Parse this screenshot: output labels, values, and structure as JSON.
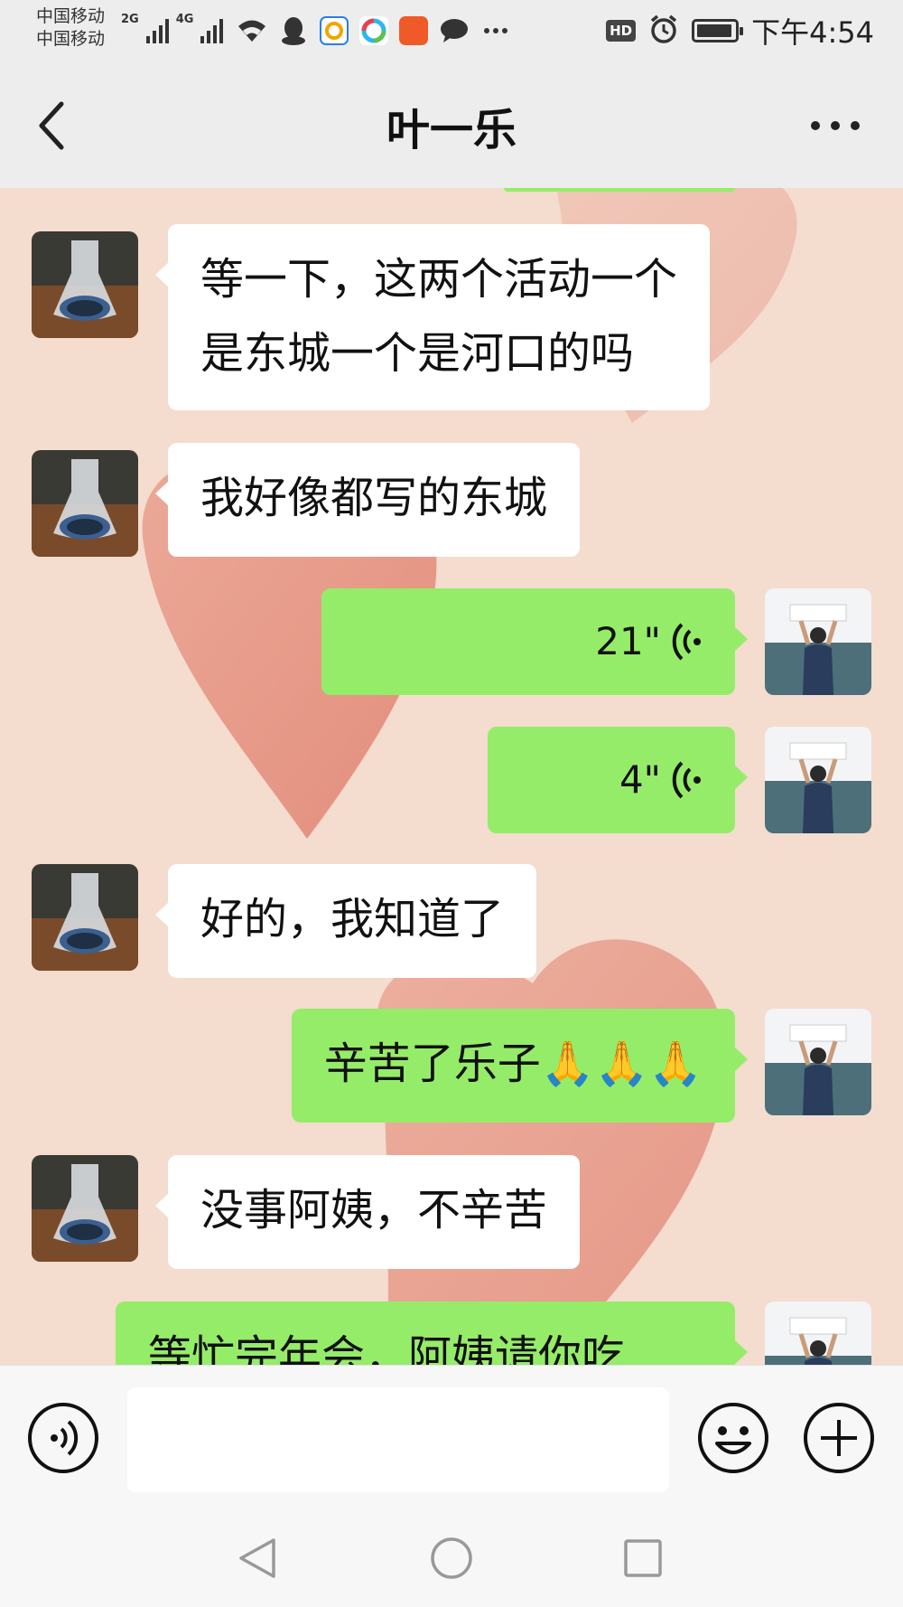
{
  "status_bar": {
    "carrier_1": "中国移动",
    "carrier_2": "中国移动",
    "net_1": "2G",
    "net_2": "4G",
    "hd": "HD",
    "time": "下午4:54",
    "battery_level": 0.95,
    "icons": [
      "signal-icon",
      "wifi-icon",
      "qq-icon",
      "app-icon",
      "app-icon",
      "app-icon",
      "chat-bubble-icon",
      "more-dots-icon",
      "alarm-icon",
      "battery-icon"
    ]
  },
  "header": {
    "title": "叶一乐",
    "back_icon": "chevron-left-icon",
    "more_icon": "more-dots-icon"
  },
  "messages": [
    {
      "id": 1,
      "side": "in",
      "text_line1": "等一下，这两个活动一个",
      "text_line2": "是东城一个是河口的吗"
    },
    {
      "id": 2,
      "side": "in",
      "text": "我好像都写的东城"
    },
    {
      "id": 3,
      "side": "out",
      "type": "voice",
      "duration": "21\""
    },
    {
      "id": 4,
      "side": "out",
      "type": "voice",
      "duration": "4\""
    },
    {
      "id": 5,
      "side": "in",
      "text": "好的，我知道了"
    },
    {
      "id": 6,
      "side": "out",
      "text": "辛苦了乐子",
      "emoji": "🙏🙏🙏"
    },
    {
      "id": 7,
      "side": "in",
      "text": "没事阿姨，不辛苦"
    },
    {
      "id": 8,
      "side": "out",
      "text": "等忙完年会，阿姨请你吃"
    }
  ],
  "input_bar": {
    "voice_icon": "voice-mode-icon",
    "placeholder": "",
    "emoji_icon": "emoji-smile-icon",
    "plus_icon": "plus-circle-icon"
  },
  "colors": {
    "outgoing_bubble": "#95ec69",
    "incoming_bubble": "#ffffff",
    "header_bg": "#ededed",
    "chat_bg": "#f4dccf"
  }
}
